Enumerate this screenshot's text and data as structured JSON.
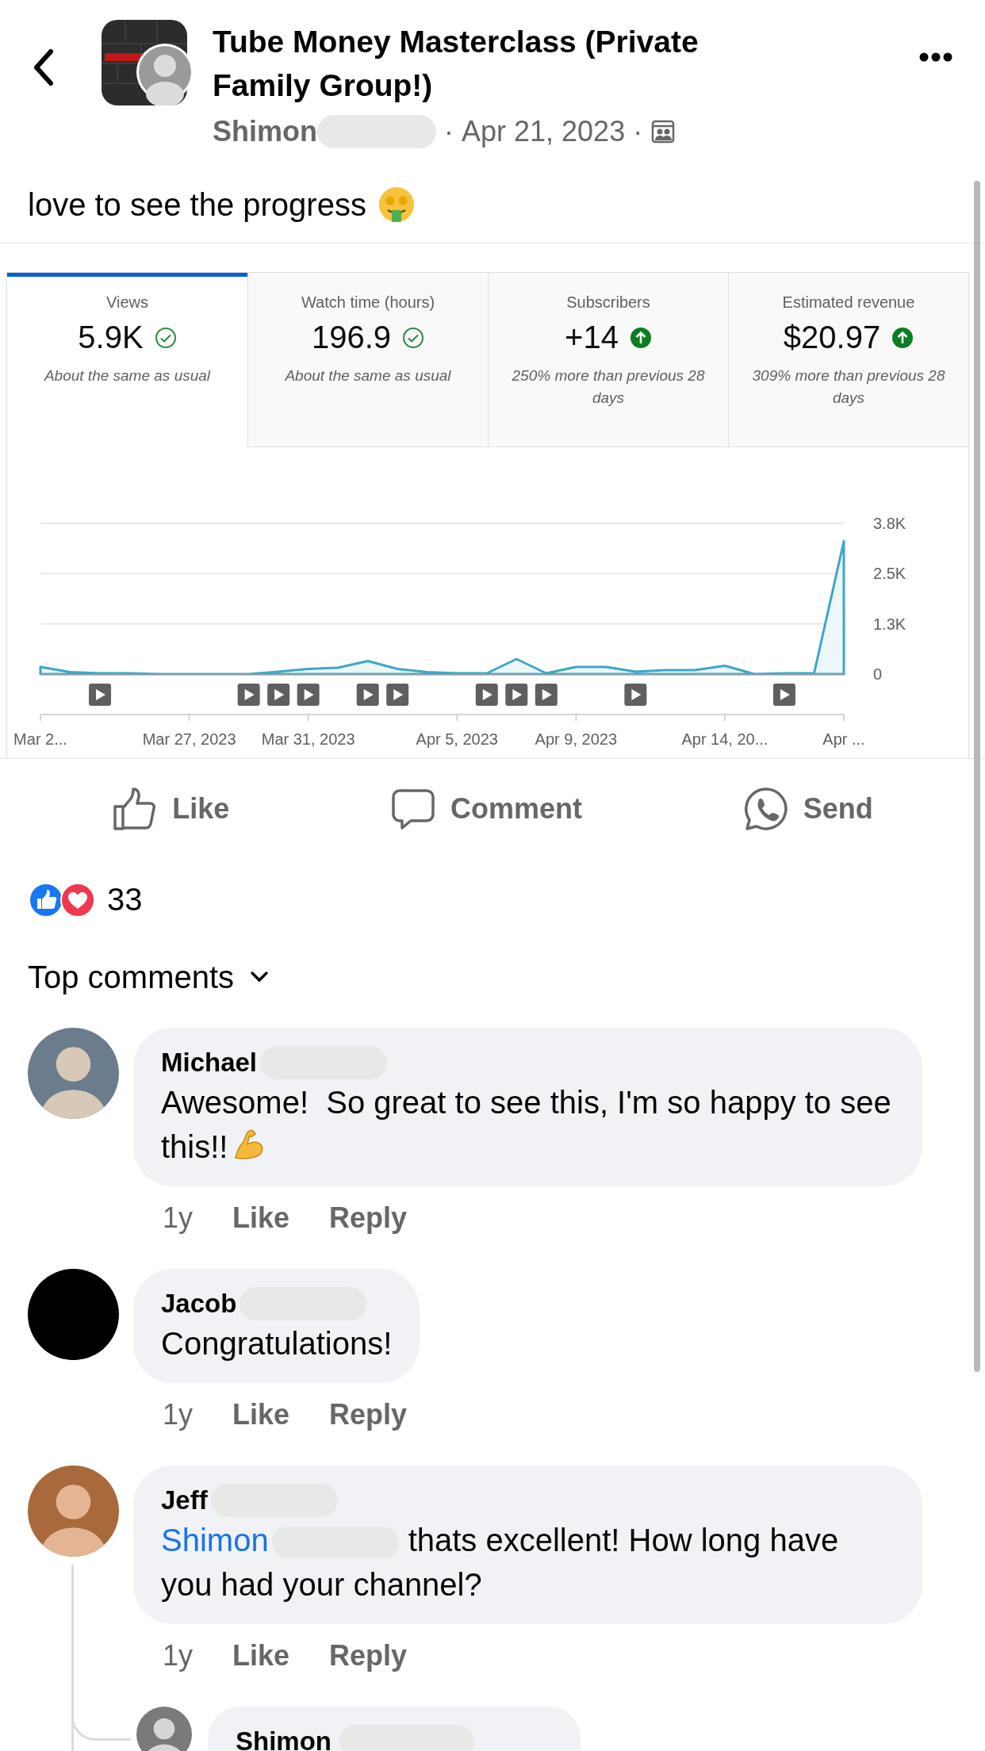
{
  "header": {
    "title": "Tube Money Masterclass (Private Family Group!)",
    "author": "Shimon",
    "author_redacted": true,
    "separators": [
      "·",
      "·"
    ],
    "date": "Apr 21, 2023"
  },
  "post": {
    "text": "love to see the progress"
  },
  "stats": [
    {
      "label": "Views",
      "value": "5.9K",
      "kind": "check",
      "note": "About the same as usual",
      "selected": true
    },
    {
      "label": "Watch time (hours)",
      "value": "196.9",
      "kind": "check",
      "note": "About the same as usual",
      "selected": false
    },
    {
      "label": "Subscribers",
      "value": "+14",
      "kind": "up",
      "note": "250% more than previous 28 days",
      "selected": false
    },
    {
      "label": "Estimated revenue",
      "value": "$20.97",
      "kind": "up",
      "note": "309% more than previous 28 days",
      "selected": false
    }
  ],
  "chart_data": {
    "type": "area",
    "categories": [
      "Mar 2...",
      null,
      null,
      null,
      null,
      "Mar 27, 2023",
      null,
      null,
      null,
      "Mar 31, 2023",
      null,
      null,
      null,
      null,
      "Apr 5, 2023",
      null,
      null,
      null,
      "Apr 9, 2023",
      null,
      null,
      null,
      null,
      "Apr 14, 20...",
      null,
      null,
      null,
      "Apr ..."
    ],
    "series": [
      {
        "color": "#3ea6c7",
        "values": [
          180,
          50,
          20,
          20,
          0,
          0,
          0,
          0,
          60,
          130,
          160,
          330,
          130,
          50,
          20,
          20,
          380,
          20,
          180,
          180,
          60,
          100,
          100,
          210,
          0,
          20,
          20,
          3350
        ]
      }
    ],
    "ylim": [
      0,
      3800
    ],
    "yticks": [
      {
        "value": 0,
        "label": "0"
      },
      {
        "value": 1267,
        "label": "1.3K"
      },
      {
        "value": 2533,
        "label": "2.5K"
      },
      {
        "value": 3800,
        "label": "3.8K"
      }
    ]
  },
  "video_markers": [
    {
      "shown": false
    },
    {
      "shown": false
    },
    {
      "shown": true
    },
    {
      "shown": false
    },
    {
      "shown": false
    },
    {
      "shown": false
    },
    {
      "shown": false
    },
    {
      "shown": true
    },
    {
      "shown": true
    },
    {
      "shown": true
    },
    {
      "shown": false
    },
    {
      "shown": true
    },
    {
      "shown": true
    },
    {
      "shown": false
    },
    {
      "shown": false
    },
    {
      "shown": true
    },
    {
      "shown": true
    },
    {
      "shown": true
    },
    {
      "shown": false
    },
    {
      "shown": false
    },
    {
      "shown": true
    },
    {
      "shown": false
    },
    {
      "shown": false
    },
    {
      "shown": false
    },
    {
      "shown": false
    },
    {
      "shown": true
    },
    {
      "shown": false
    },
    {
      "shown": false
    }
  ],
  "actions": [
    {
      "kind": "like",
      "label": "Like"
    },
    {
      "kind": "comment",
      "label": "Comment"
    },
    {
      "kind": "send",
      "label": "Send"
    }
  ],
  "reactions": {
    "count": "33"
  },
  "comments_header": {
    "label": "Top comments"
  },
  "comments": [
    {
      "name": "Michael",
      "name_redacted": true,
      "text": "Awesome!  So great to see this, I'm so happy to see this!!",
      "has_emoji": true,
      "time": "1y",
      "like": "Like",
      "reply": "Reply"
    },
    {
      "name": "Jacob",
      "name_redacted": true,
      "text": "Congratulations!",
      "has_emoji": false,
      "time": "1y",
      "like": "Like",
      "reply": "Reply"
    },
    {
      "name": "Jeff",
      "name_redacted": true,
      "mention": "Shimon",
      "mention_redacted": true,
      "text": "thats excellent! How long have you had your channel?",
      "has_emoji": false,
      "time": "1y",
      "like": "Like",
      "reply": "Reply",
      "replies": [
        {
          "name": "Shimon",
          "name_redacted": true
        }
      ]
    }
  ]
}
